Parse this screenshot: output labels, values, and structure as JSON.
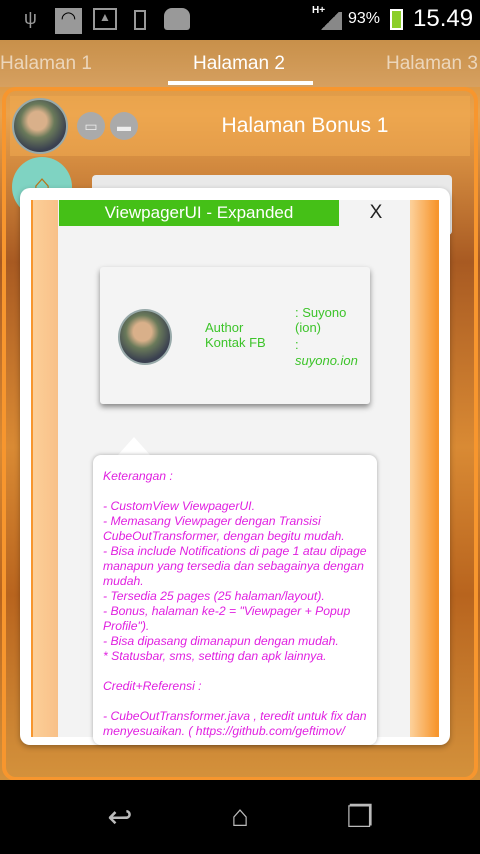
{
  "status_bar": {
    "network": "H+",
    "battery": "93%",
    "time": "15.49",
    "icons": [
      "usb-icon",
      "wifi-icon",
      "image-icon",
      "phone-icon",
      "android-icon"
    ]
  },
  "tabs": [
    {
      "label": "Halaman 1"
    },
    {
      "label": "Halaman 2",
      "active": true
    },
    {
      "label": "Halaman 3"
    }
  ],
  "header": {
    "title": "Halaman Bonus 1"
  },
  "popup": {
    "title": "ViewpagerUI - Expanded",
    "close_label": "X",
    "accent": "#45c017"
  },
  "profile": {
    "author_label": "Author",
    "author_value": ": Suyono (ion)",
    "contact_label": "Kontak FB",
    "contact_colon": ":",
    "contact_value": "suyono.ion"
  },
  "info": {
    "lines": [
      "Keterangan :",
      "",
      "- CustomView ViewpagerUI.",
      "- Memasang Viewpager dengan Transisi CubeOutTransformer, dengan begitu mudah.",
      "- Bisa include Notifications di page 1 atau dipage manapun yang tersedia dan sebagainya dengan mudah.",
      "- Tersedia 25 pages (25 halaman/layout).",
      "- Bonus, halaman ke-2 = \"Viewpager + Popup Profile\").",
      "- Bisa dipasang dimanapun dengan mudah.",
      "* Statusbar, sms, setting dan apk lainnya.",
      "",
      "Credit+Referensi :",
      "",
      "- CubeOutTransformer.java , teredit untuk fix dan menyesuaikan. ( https://github.com/geftimov/"
    ]
  }
}
